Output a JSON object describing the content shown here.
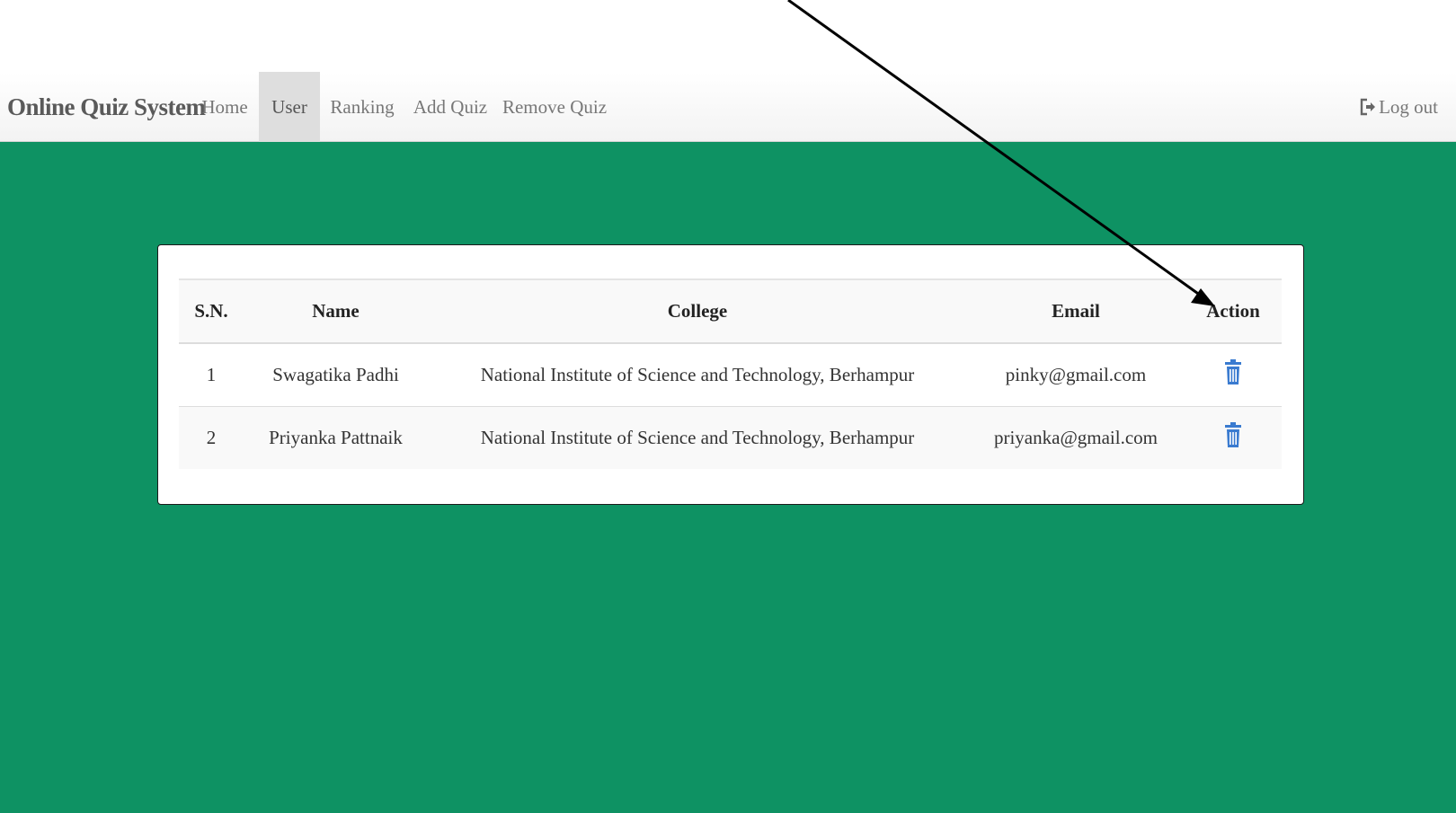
{
  "navbar": {
    "brand": "Online Quiz System",
    "items": [
      {
        "label": "Home",
        "active": false
      },
      {
        "label": "User",
        "active": true
      },
      {
        "label": "Ranking",
        "active": false
      },
      {
        "label": "Add Quiz",
        "active": false
      },
      {
        "label": "Remove Quiz",
        "active": false
      }
    ],
    "logout_label": "Log out",
    "logout_icon": "log-out-icon"
  },
  "table": {
    "headers": [
      "S.N.",
      "Name",
      "College",
      "Email",
      "Action"
    ],
    "rows": [
      {
        "sn": "1",
        "name": "Swagatika Padhi",
        "college": "National Institute of Science and Technology, Berhampur",
        "email": "pinky@gmail.com",
        "action_icon": "trash-icon"
      },
      {
        "sn": "2",
        "name": "Priyanka Pattnaik",
        "college": "National Institute of Science and Technology, Berhampur",
        "email": "priyanka@gmail.com",
        "action_icon": "trash-icon"
      }
    ]
  },
  "colors": {
    "background": "#0e9263",
    "trash_icon": "#3a7bd0",
    "active_nav": "#dedede"
  }
}
